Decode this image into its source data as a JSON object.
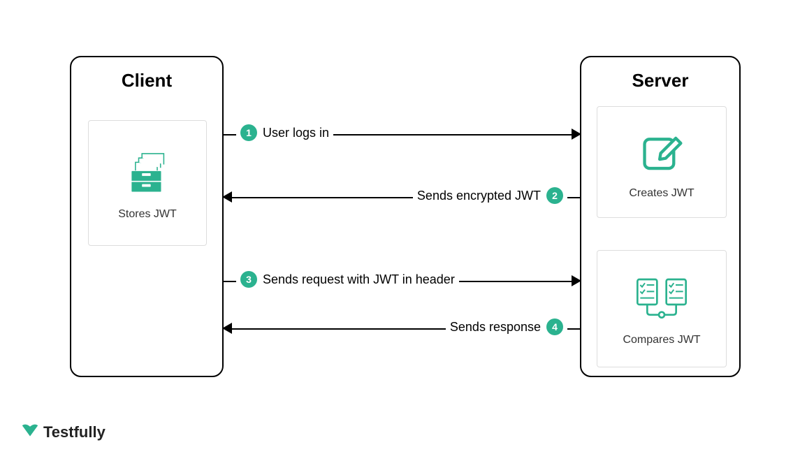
{
  "client": {
    "title": "Client",
    "card_label": "Stores JWT"
  },
  "server": {
    "title": "Server",
    "card1_label": "Creates JWT",
    "card2_label": "Compares JWT"
  },
  "arrows": {
    "step1": {
      "num": "1",
      "text": "User logs in"
    },
    "step2": {
      "num": "2",
      "text": "Sends encrypted JWT"
    },
    "step3": {
      "num": "3",
      "text": "Sends request with JWT in header"
    },
    "step4": {
      "num": "4",
      "text": "Sends response"
    }
  },
  "brand": {
    "name": "Testfully"
  },
  "colors": {
    "accent": "#2bb28f"
  }
}
